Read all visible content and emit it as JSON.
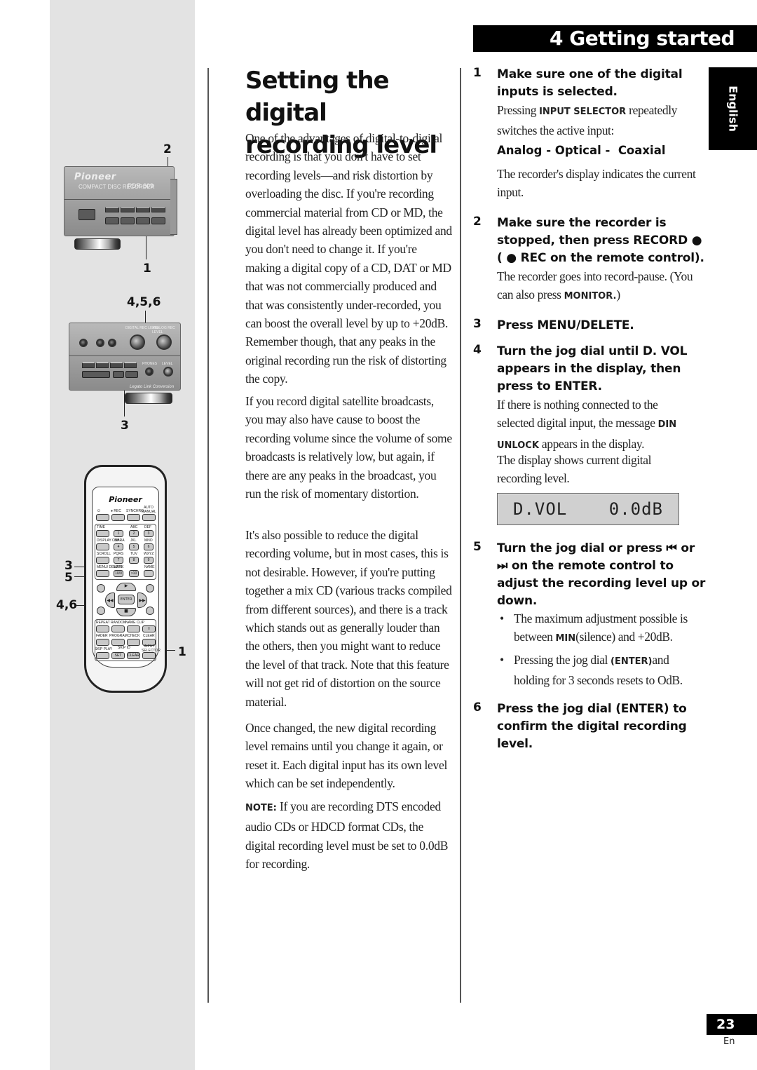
{
  "header": {
    "chapter_title": "4 Getting started"
  },
  "language_tab": "English",
  "figure": {
    "callouts": {
      "panel_top_2": "2",
      "panel_top_1": "1",
      "panel_bottom_456": "4,5,6",
      "panel_bottom_3": "3",
      "remote_3": "3",
      "remote_5": "5",
      "remote_46": "4,6",
      "remote_1": "1"
    },
    "front_panel": {
      "brand": "Pioneer",
      "model": "PDR-609",
      "subtitle": "COMPACT DISC RECORDER",
      "knob_labels": [
        "DIGITAL REC LEVEL",
        "ANALOG REC LEVEL"
      ],
      "phones_label": "PHONES",
      "level_label": "LEVEL",
      "legato_label": "Legato Link Conversion"
    },
    "remote": {
      "brand": "Pioneer",
      "top_row": [
        "⏻",
        "● REC",
        "SYNCHRO",
        "AUTO MANUAL"
      ],
      "side_keys": [
        "TIME",
        "DISPLAY CHARA",
        "SCROLL",
        "MENU/ DELETE"
      ],
      "num_labels": [
        "",
        "ABC",
        "DEF",
        "GHI",
        "JKL",
        "MNO",
        "PQRS",
        "TUV",
        "WXYZ",
        "MARK",
        "",
        "NAME"
      ],
      "num_keys": [
        "1",
        "2",
        "3",
        "4",
        "5",
        "6",
        "7",
        "8",
        "9",
        "10/0",
        ">10",
        ""
      ],
      "transport": {
        "play": "▶",
        "rew": "◀◀",
        "ff": "▶▶",
        "enter": "ENTER",
        "stop": "■"
      },
      "func_row1": [
        "REPEAT",
        "RANDOM",
        "NAME CLIP",
        "‖"
      ],
      "func_row2": [
        "FADER",
        "PROGRAM",
        "CHECK",
        "CLEAR"
      ],
      "func_row3_labels": [
        "SKIP PLAY",
        "SKIP ID",
        "",
        "INPUT SELECTOR"
      ],
      "func_row3_keys": [
        "",
        "SET",
        "CLEAR",
        ""
      ]
    }
  },
  "main": {
    "title": "Setting the digital recording level",
    "paragraphs": [
      "One of the advantages of digital-to-digital recording is that you don't have to set recording levels—and risk distortion by overloading the disc. If you're recording commercial material from CD or MD, the digital level has already been optimized and you don't need to change it. If you're making a digital copy of a CD, DAT or MD that was not commercially produced and that was consistently under-recorded, you can boost the overall level by up to +20dB. Remember though, that any peaks in the original recording run the risk of distorting the copy.",
      "If you record digital satellite broadcasts, you may also have cause to boost the recording volume since the volume of some broadcasts is relatively low, but again, if there are any peaks in the broadcast, you run the risk of momentary distortion.",
      "It's also possible to reduce the digital recording volume, but in most cases, this is not desirable. However, if you're putting together a mix CD (various tracks compiled from different sources), and there is a track which stands out as generally louder than the others, then you might want to reduce the level of that track. Note that this feature will not get rid of distortion on the source material.",
      "Once changed, the new digital recording level remains until you change it again, or reset it. Each digital input has its own level which can be set independently."
    ],
    "note": {
      "label": "NOTE:",
      "text": " If you are recording DTS encoded audio CDs or HDCD format CDs, the digital recording level must be set to 0.0dB for recording."
    }
  },
  "steps": [
    {
      "num": "1",
      "heading": "Make sure one of the digital inputs is selected.",
      "body_pre": "Pressing ",
      "body_key": "INPUT SELECTOR",
      "body_post": " repeatedly switches the active input:",
      "sequence": "Analog - Optical -  Coaxial",
      "body2": "The recorder's display indicates the current input."
    },
    {
      "num": "2",
      "heading": "Make sure the recorder is stopped, then press RECORD ● ( ● REC on the remote control).",
      "body_pre": "The recorder goes into record-pause. (You can also press ",
      "body_key": "MONITOR.",
      "body_post": ")"
    },
    {
      "num": "3",
      "heading": "Press MENU/DELETE."
    },
    {
      "num": "4",
      "heading": "Turn the jog dial until D. VOL appears in the display, then press to ENTER.",
      "body_pre": "If there is nothing connected to the selected digital input, the message ",
      "body_key": "DIN UNLOCK",
      "body_post": " appears in the display.",
      "body2": "The display shows  current digital recording level."
    },
    {
      "num": "5",
      "heading": "Turn the jog dial or press ⏮ or ⏭ on the remote control to adjust the recording level up or down.",
      "bullets": [
        {
          "pre": "The maximum adjustment possible is between ",
          "key": "MIN",
          "post": "(silence) and +20dB."
        },
        {
          "pre": "Pressing the jog dial ",
          "key": "(ENTER)",
          "post": "and holding for 3 seconds resets to OdB."
        }
      ]
    },
    {
      "num": "6",
      "heading": "Press the jog dial (ENTER) to confirm the digital recording level."
    }
  ],
  "display_readout": {
    "label": "D.VOL",
    "value": "0.0dB"
  },
  "footer": {
    "page_number": "23",
    "language_code": "En"
  }
}
